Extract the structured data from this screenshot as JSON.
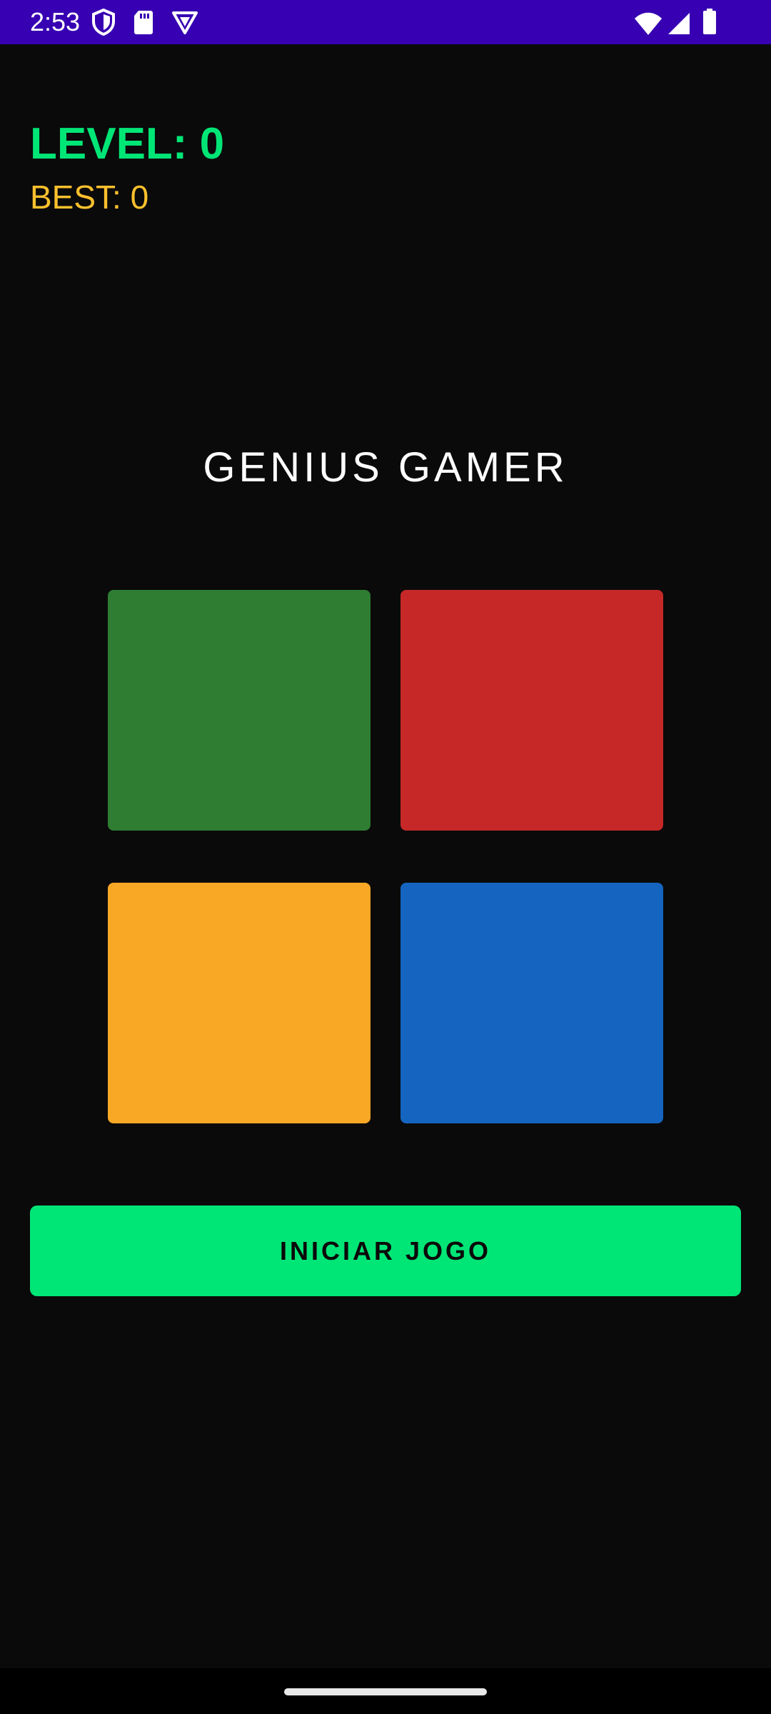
{
  "status_bar": {
    "time": "2:53",
    "background": "#3700b3",
    "left_icons": [
      "shield-icon",
      "sd-card-icon",
      "vpn-icon"
    ],
    "right_icons": [
      "wifi-icon",
      "cellular-signal-icon",
      "battery-icon"
    ]
  },
  "scores": {
    "level_text": "LEVEL: 0",
    "best_text": "BEST: 0",
    "level_color": "#00e676",
    "best_color": "#fbc02d"
  },
  "game": {
    "title": "GENIUS GAMER",
    "pads": [
      {
        "name": "green",
        "color": "#2e7d32"
      },
      {
        "name": "red",
        "color": "#c62828"
      },
      {
        "name": "yellow",
        "color": "#f9a825"
      },
      {
        "name": "blue",
        "color": "#1565c0"
      }
    ]
  },
  "actions": {
    "start_label": "INICIAR JOGO",
    "start_color": "#00e676"
  }
}
